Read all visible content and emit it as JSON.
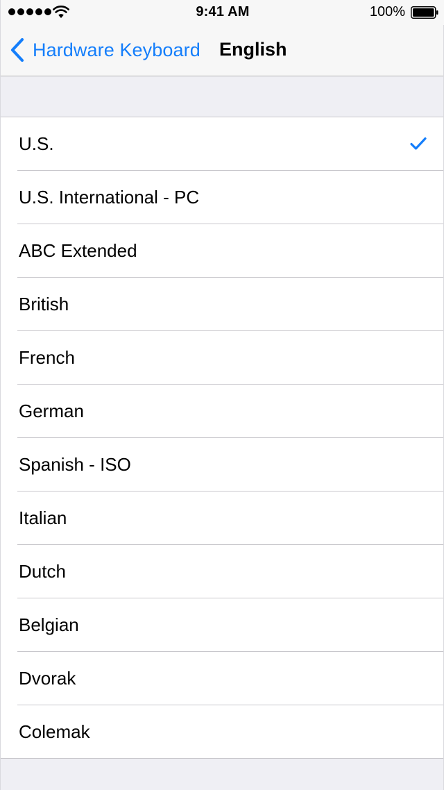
{
  "status_bar": {
    "time": "9:41 AM",
    "battery_percent": "100%",
    "signal_icon": "signal-dots-icon",
    "wifi_icon": "wifi-icon",
    "battery_icon": "battery-icon"
  },
  "nav": {
    "back_label": "Hardware Keyboard",
    "back_icon": "chevron-left-icon",
    "title": "English"
  },
  "colors": {
    "accent": "#147efb",
    "background": "#efeff4",
    "separator": "#c8c7cc"
  },
  "layouts": {
    "selected": "U.S.",
    "checkmark_icon": "checkmark-icon",
    "items": [
      "U.S.",
      "U.S. International - PC",
      "ABC Extended",
      "British",
      "French",
      "German",
      "Spanish - ISO",
      "Italian",
      "Dutch",
      "Belgian",
      "Dvorak",
      "Colemak"
    ]
  }
}
